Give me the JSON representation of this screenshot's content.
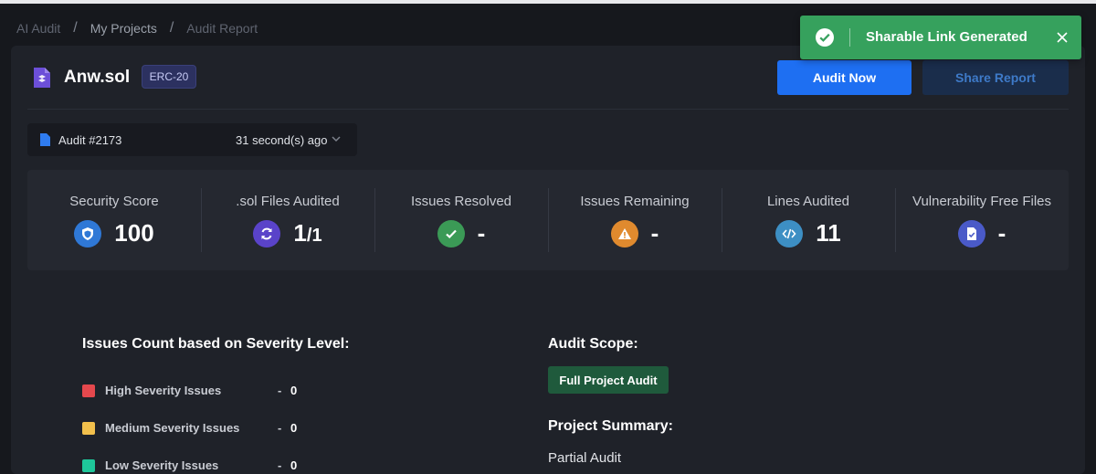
{
  "breadcrumb": {
    "root": "AI Audit",
    "projects": "My Projects",
    "current": "Audit Report"
  },
  "toast": {
    "message": "Sharable Link Generated",
    "icon": "check-circle-icon",
    "close_icon": "close-icon",
    "color": "#36a15d"
  },
  "project": {
    "name": "Anw.sol",
    "token_type": "ERC-20",
    "icon": "solidity-file-icon"
  },
  "actions": {
    "audit_now": "Audit Now",
    "share_report": "Share Report"
  },
  "audit_select": {
    "audit_id": "Audit #2173",
    "time_ago": "31 second(s) ago"
  },
  "stats": [
    {
      "label": "Security Score",
      "value": "100",
      "icon": "shield-icon",
      "color": "#2f78d6"
    },
    {
      "label": ".sol Files Audited",
      "value": "1",
      "total": "/1",
      "icon": "sync-icon",
      "color": "#5a43c9"
    },
    {
      "label": "Issues Resolved",
      "value": "-",
      "icon": "check-icon",
      "color": "#3b9a56"
    },
    {
      "label": "Issues Remaining",
      "value": "-",
      "icon": "warning-icon",
      "color": "#e08a2e"
    },
    {
      "label": "Lines Audited",
      "value": "11",
      "icon": "code-icon",
      "color": "#3d8fc4"
    },
    {
      "label": "Vulnerability Free Files",
      "value": "-",
      "icon": "file-check-icon",
      "color": "#4a5ac8"
    }
  ],
  "severity": {
    "title": "Issues Count based on Severity Level:",
    "rows": [
      {
        "label": "High Severity Issues",
        "count": "0",
        "color": "#e5484d"
      },
      {
        "label": "Medium Severity Issues",
        "count": "0",
        "color": "#f2c04c"
      },
      {
        "label": "Low Severity Issues",
        "count": "0",
        "color": "#1ec79a"
      }
    ]
  },
  "scope": {
    "title": "Audit Scope:",
    "badge": "Full Project Audit"
  },
  "summary": {
    "title": "Project Summary:",
    "text": "Partial Audit"
  }
}
